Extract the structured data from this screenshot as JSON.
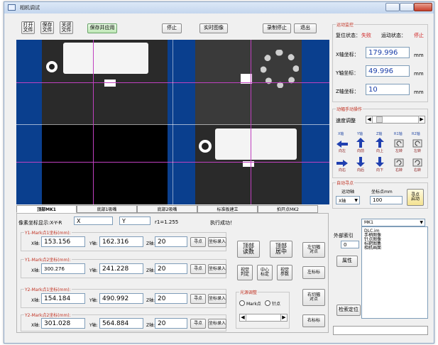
{
  "window": {
    "title": "相机调试"
  },
  "toolbar": {
    "open_label": "打开\n文件",
    "save_label": "保存\n文件",
    "close_label": "关闭\n文件",
    "save_apply_label": "保存并应用",
    "stop_label": "停止",
    "live_label": "实时图像",
    "record_stop_label": "录制停止",
    "exit_label": "退出"
  },
  "motion": {
    "title": "运动监控",
    "reset_label": "复位状态：",
    "reset_value": "失败",
    "run_label": "运动状态：",
    "run_value": "停止",
    "x_label": "X轴坐标：",
    "x_value": "179.996",
    "y_label": "Y轴坐标：",
    "y_value": "49.996",
    "z_label": "Z轴坐标：",
    "z_value": "10",
    "unit": "mm"
  },
  "manual": {
    "title": "动幅手动操作",
    "speed_label": "速度调整",
    "axes": [
      "X轴",
      "Y轴",
      "Z轴",
      "R1轴",
      "R2轴"
    ],
    "top_buttons": [
      "向左",
      "向前",
      "向上",
      "左转",
      "左转"
    ],
    "bottom_buttons": [
      "向右",
      "向后",
      "向下",
      "右转",
      "右转"
    ]
  },
  "auto": {
    "title": "自动寻点",
    "axis_label": "运动轴",
    "coord_label": "坐标点mm",
    "axis_value": "X轴",
    "coord_value": "100",
    "find_label": "寻点\n启动"
  },
  "tabs": [
    "顶部MK1",
    "底部1吸嘴",
    "底部2吸嘴",
    "标准板建立",
    "拍开点MK2"
  ],
  "coords": {
    "display_label": "像素坐标显示:X-Y-R",
    "x_value": "X",
    "y_value": "Y",
    "r_text": "r1=1.255",
    "status": "执行成功！"
  },
  "marks": [
    {
      "title": "Y1-Mark点1坐标(mm):",
      "x": "153.156",
      "y": "162.316",
      "z": "20"
    },
    {
      "title": "Y1-Mark点2坐标(mm):",
      "x": "300.276",
      "y": "241.228",
      "z": "20"
    },
    {
      "title": "Y2-Mark点1坐标(mm):",
      "x": "154.184",
      "y": "490.992",
      "z": "20"
    },
    {
      "title": "Y2-Mark点2坐标(mm):",
      "x": "301.028",
      "y": "564.884",
      "z": "20"
    }
  ],
  "mark_labels": {
    "x": "X轴:",
    "y": "Y轴:",
    "z": "Z轴:",
    "find": "寻点",
    "record": "坐标录入"
  },
  "actions": {
    "top_read": "顶部\n读数",
    "top_center": "顶部\n居中",
    "left_align": "左切幅\n对点",
    "btn_a": "视觉\n判定",
    "btn_b": "中心\n标定",
    "btn_c": "视觉\n参数",
    "left_std": "左标标",
    "right_align": "右切幅\n对点",
    "right_std": "右标标"
  },
  "light": {
    "title": "光源调整",
    "opt1": "Mark点",
    "opt2": "针点"
  },
  "side": {
    "select_value": "MK1",
    "index_label": "外部索引",
    "index_value": "0",
    "attr_label": "属性",
    "locate_label": "检索定位",
    "list": [
      "DLC.im",
      "手柄图像",
      "针点图像",
      "标靶图集",
      "相机画面"
    ]
  }
}
